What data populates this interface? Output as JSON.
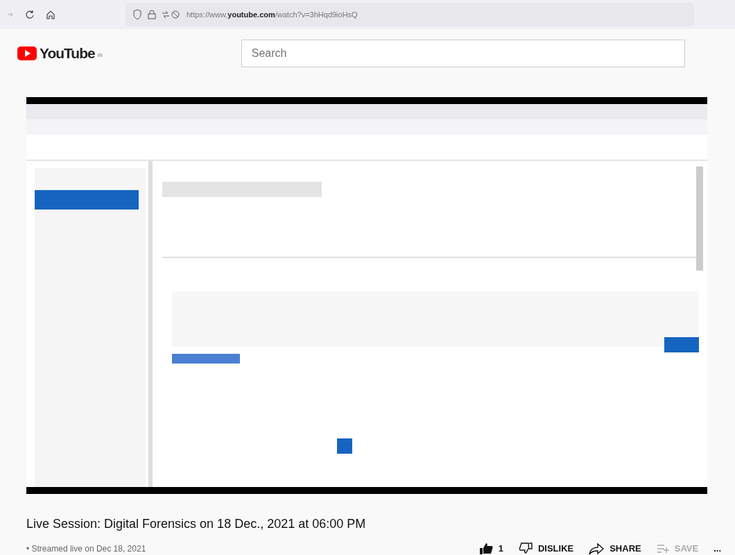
{
  "browser": {
    "url_host_prefix": "https://www.",
    "url_host": "youtube.com",
    "url_path": "/watch?v=3hHqd9ioHsQ"
  },
  "header": {
    "logo": "YouTube",
    "region": "IN",
    "search": {
      "placeholder": "Search"
    }
  },
  "title": "Live Session: Digital Forensics on 18 Dec., 2021 at 06:00 PM",
  "meta": "• Streamed live on Dec 18, 2021",
  "actions": [
    {
      "kind": "like",
      "label": "1",
      "disabled": false
    },
    {
      "kind": "dislike",
      "label": "DISLIKE",
      "disabled": false
    },
    {
      "kind": "share",
      "label": "SHARE",
      "disabled": false
    },
    {
      "kind": "save",
      "label": "SAVE",
      "disabled": true
    },
    {
      "kind": "more",
      "label": "...",
      "disabled": false
    }
  ]
}
